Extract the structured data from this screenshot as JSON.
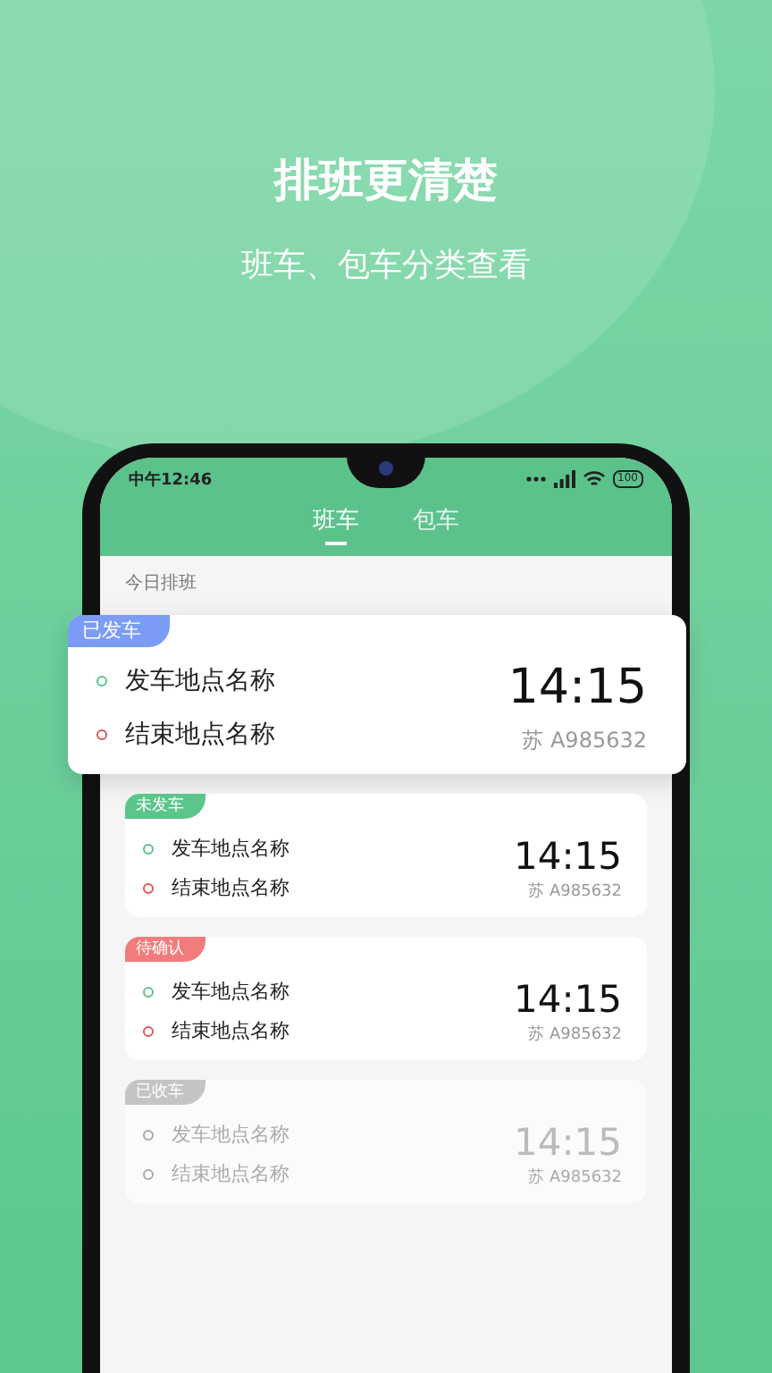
{
  "headline": "排班更清楚",
  "subtitle": "班车、包车分类查看",
  "status_bar": {
    "time": "中午12:46",
    "battery": "100"
  },
  "tabs": [
    {
      "label": "班车",
      "selected": true
    },
    {
      "label": "包车",
      "selected": false
    }
  ],
  "section_title": "今日排班",
  "trips": [
    {
      "status": "已发车",
      "color": "#7b9cf5",
      "featured": true,
      "disabled": false,
      "start": "发车地点名称",
      "end": "结束地点名称",
      "time": "14:15",
      "plate": "苏 A985632"
    },
    {
      "status": "未发车",
      "color": "#5cc58c",
      "featured": false,
      "disabled": false,
      "start": "发车地点名称",
      "end": "结束地点名称",
      "time": "14:15",
      "plate": "苏 A985632"
    },
    {
      "status": "待确认",
      "color": "#f27c7c",
      "featured": false,
      "disabled": false,
      "start": "发车地点名称",
      "end": "结束地点名称",
      "time": "14:15",
      "plate": "苏 A985632"
    },
    {
      "status": "已收车",
      "color": "#c4c4c4",
      "featured": false,
      "disabled": true,
      "start": "发车地点名称",
      "end": "结束地点名称",
      "time": "14:15",
      "plate": "苏 A985632"
    }
  ]
}
